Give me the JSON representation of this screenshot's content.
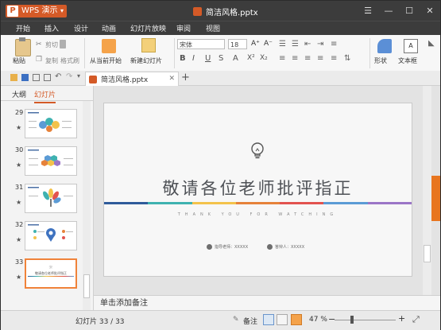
{
  "app": {
    "name": "WPS 演示",
    "badge": "P",
    "doc_title": "简洁风格.pptx"
  },
  "menu": [
    "开始",
    "插入",
    "设计",
    "动画",
    "幻灯片放映",
    "审阅",
    "视图"
  ],
  "ribbon": {
    "paste": "粘贴",
    "cut": "剪切",
    "copy": "复制",
    "format_painter": "格式刷",
    "from_current": "从当前开始",
    "new_slide": "新建幻灯片",
    "font_name": "宋体",
    "font_size": "18",
    "shape": "形状",
    "textbox": "文本框"
  },
  "tab": {
    "label": "简洁风格.pptx"
  },
  "pane_tabs": {
    "outline": "大纲",
    "slides": "幻灯片"
  },
  "thumbnails": [
    {
      "number": "29"
    },
    {
      "number": "30"
    },
    {
      "number": "31"
    },
    {
      "number": "32"
    },
    {
      "number": "33",
      "text": "敬请各位老师批评指正"
    }
  ],
  "slide": {
    "title": "敬请各位老师批评指正",
    "subtitle": "THANK YOU FOR WATCHING",
    "advisor": "指导老师：XXXXX",
    "presenter": "答辩人：XXXXX",
    "line_colors": [
      "#2f5b9a",
      "#3fb2b0",
      "#f3c24b",
      "#e6823a",
      "#e2534f",
      "#5b9bd5",
      "#9b76c7"
    ]
  },
  "notes": {
    "placeholder": "单击添加备注"
  },
  "status": {
    "slide_count": "幻灯片 33 / 33",
    "notes_label": "备注",
    "zoom": "47 %"
  },
  "colors": {
    "accent": "#d45a27",
    "titlebar": "#3c3c3c",
    "selected_thumb": "#f0833a"
  }
}
